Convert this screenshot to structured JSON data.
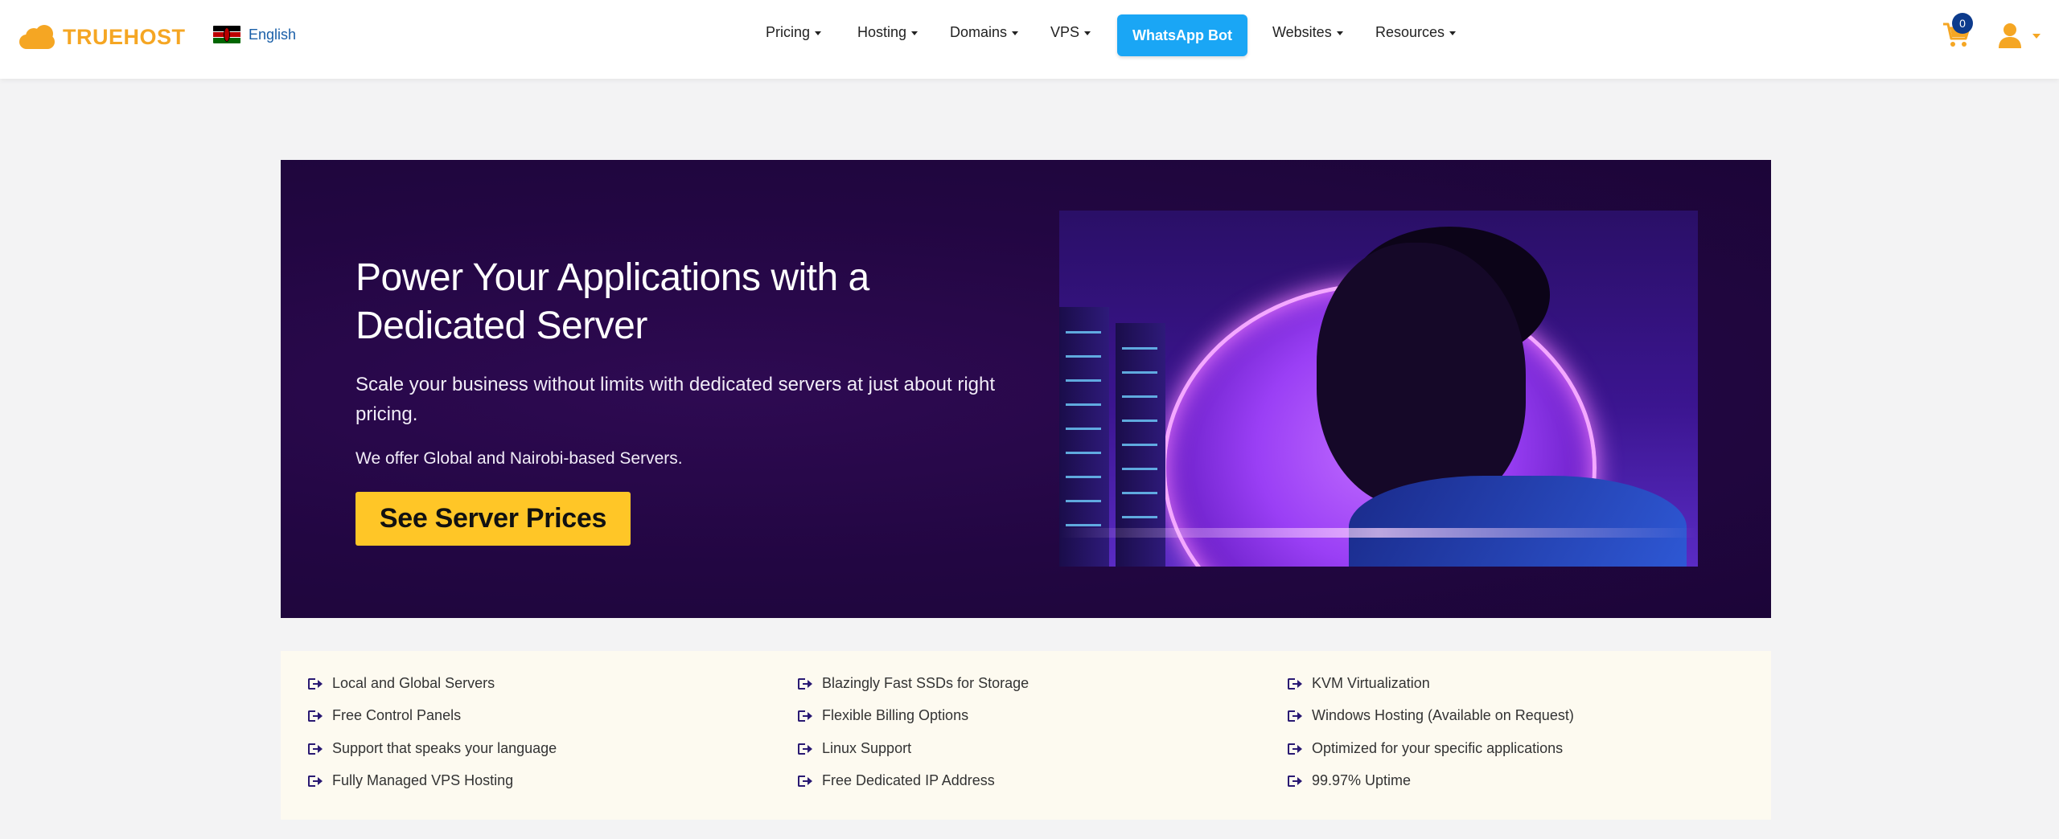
{
  "header": {
    "logo_text": "TRUEHOST",
    "language": "English",
    "nav": [
      {
        "label": "Pricing"
      },
      {
        "label": "Hosting"
      },
      {
        "label": "Domains"
      },
      {
        "label": "VPS"
      },
      {
        "label": "Websites"
      },
      {
        "label": "Resources"
      }
    ],
    "whatsapp_label": "WhatsApp Bot",
    "cart_count": "0"
  },
  "hero": {
    "title": "Power Your Applications with a Dedicated Server",
    "subtitle": "Scale your business without limits with dedicated servers at just about right pricing.",
    "note": "We offer Global and Nairobi-based Servers.",
    "cta_label": "See Server Prices"
  },
  "features": {
    "columns": [
      [
        "Local and Global Servers",
        "Free Control Panels",
        "Support that speaks your language",
        "Fully Managed VPS Hosting"
      ],
      [
        "Blazingly Fast SSDs for Storage",
        "Flexible Billing Options",
        "Linux Support",
        "Free Dedicated IP Address"
      ],
      [
        "KVM Virtualization",
        "Windows Hosting (Available on Request)",
        "Optimized for your specific applications",
        "99.97% Uptime"
      ]
    ]
  },
  "colors": {
    "brand": "#f5a623",
    "whatsapp": "#1aa6f5",
    "hero_bg": "#220642",
    "cta": "#ffc627",
    "feature_icon": "#2a1a73"
  }
}
